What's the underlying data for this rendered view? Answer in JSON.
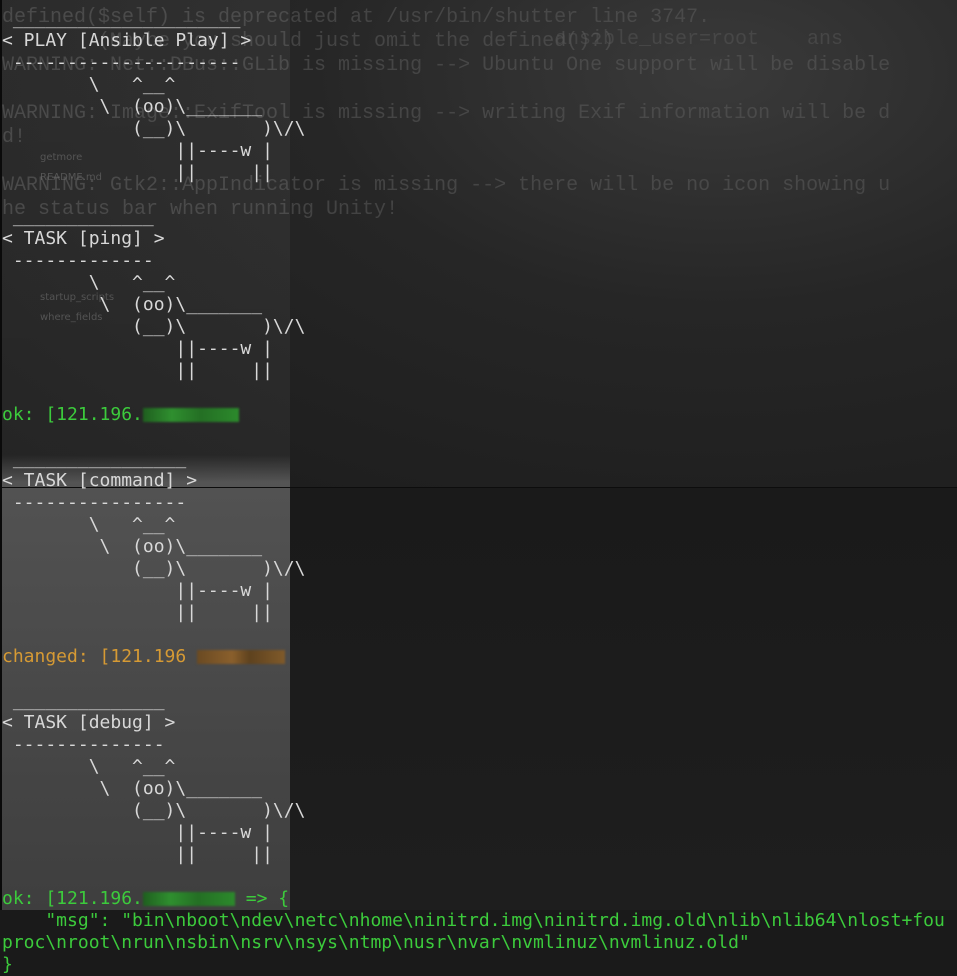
{
  "background": {
    "lines": [
      {
        "text": "defined($self) is deprecated at /usr/bin/shutter line 3747."
      },
      {
        "text": "        (Maybe you should just omit the defined()?)"
      },
      {
        "text": "WARNING: Net::DBus::GLib is missing --> Ubuntu One support will be disable"
      },
      {
        "text": ""
      },
      {
        "text": "WARNING: Image::ExifTool is missing --> writing Exif information will be d"
      },
      {
        "text": "d!"
      },
      {
        "text": ""
      },
      {
        "text": "WARNING: Gtk2::AppIndicator is missing --> there will be no icon showing u"
      },
      {
        "text": "he status bar when running Unity!"
      }
    ],
    "ghost_right_top": "ansible_user=root    ans",
    "files": [
      "",
      "",
      "",
      "",
      "getmore",
      "README.md",
      "",
      "",
      "",
      "",
      "",
      "startup_scripts",
      "where_fields"
    ]
  },
  "terminal": {
    "lines": [
      {
        "text": " _____________________",
        "cls": ""
      },
      {
        "text": "< PLAY [Ansible Play] >",
        "cls": ""
      },
      {
        "text": " ---------------------",
        "cls": ""
      },
      {
        "text": "        \\   ^__^",
        "cls": ""
      },
      {
        "text": "         \\  (oo)\\_______",
        "cls": ""
      },
      {
        "text": "            (__)\\       )\\/\\",
        "cls": ""
      },
      {
        "text": "                ||----w |",
        "cls": ""
      },
      {
        "text": "                ||     ||",
        "cls": ""
      },
      {
        "text": "",
        "cls": ""
      },
      {
        "text": " _____________",
        "cls": ""
      },
      {
        "text": "< TASK [ping] >",
        "cls": ""
      },
      {
        "text": " -------------",
        "cls": ""
      },
      {
        "text": "        \\   ^__^",
        "cls": ""
      },
      {
        "text": "         \\  (oo)\\_______",
        "cls": ""
      },
      {
        "text": "            (__)\\       )\\/\\",
        "cls": ""
      },
      {
        "text": "                ||----w |",
        "cls": ""
      },
      {
        "text": "                ||     ||",
        "cls": ""
      },
      {
        "text": "",
        "cls": ""
      },
      {
        "text": "ok: [121.196.",
        "cls": "ok",
        "blur": "g",
        "blur_w": 96
      },
      {
        "text": "",
        "cls": ""
      },
      {
        "text": " ________________",
        "cls": ""
      },
      {
        "text": "< TASK [command] >",
        "cls": ""
      },
      {
        "text": " ----------------",
        "cls": ""
      },
      {
        "text": "        \\   ^__^",
        "cls": ""
      },
      {
        "text": "         \\  (oo)\\_______",
        "cls": ""
      },
      {
        "text": "            (__)\\       )\\/\\",
        "cls": ""
      },
      {
        "text": "                ||----w |",
        "cls": ""
      },
      {
        "text": "                ||     ||",
        "cls": ""
      },
      {
        "text": "",
        "cls": ""
      },
      {
        "text": "changed: [121.196 ",
        "cls": "changed",
        "blur": "o",
        "blur_w": 88
      },
      {
        "text": "",
        "cls": ""
      },
      {
        "text": " ______________",
        "cls": ""
      },
      {
        "text": "< TASK [debug] >",
        "cls": ""
      },
      {
        "text": " --------------",
        "cls": ""
      },
      {
        "text": "        \\   ^__^",
        "cls": ""
      },
      {
        "text": "         \\  (oo)\\_______",
        "cls": ""
      },
      {
        "text": "            (__)\\       )\\/\\",
        "cls": ""
      },
      {
        "text": "                ||----w |",
        "cls": ""
      },
      {
        "text": "                ||     ||",
        "cls": ""
      },
      {
        "text": "",
        "cls": ""
      },
      {
        "text": "ok: [121.196.",
        "cls": "ok",
        "blur": "g",
        "blur_w": 92,
        "after": " => {"
      },
      {
        "text": "    \"msg\": \"bin\\nboot\\ndev\\netc\\nhome\\ninitrd.img\\ninitrd.img.old\\nlib\\nlib64\\nlost+fou",
        "cls": "ok"
      },
      {
        "text": "proc\\nroot\\nrun\\nsbin\\nsrv\\nsys\\ntmp\\nusr\\nvar\\nvmlinuz\\nvmlinuz.old\"",
        "cls": "ok"
      },
      {
        "text": "}",
        "cls": "ok"
      }
    ]
  }
}
